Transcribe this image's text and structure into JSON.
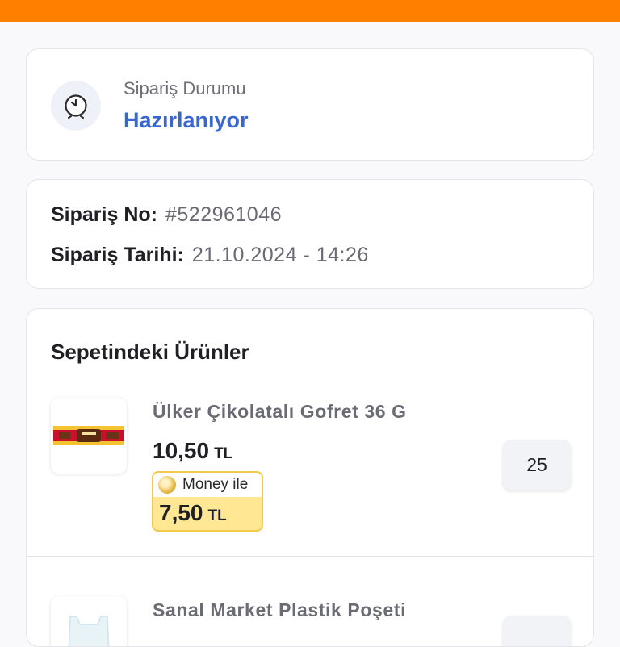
{
  "status": {
    "label": "Sipariş Durumu",
    "value": "Hazırlanıyor",
    "icon": "clock-icon",
    "value_color": "#3a67cf"
  },
  "order": {
    "number_label": "Sipariş No:",
    "number_value": "#522961046",
    "date_label": "Sipariş Tarihi:",
    "date_value": "21.10.2024 - 14:26"
  },
  "products": {
    "title": "Sepetindeki Ürünler",
    "items": [
      {
        "name": "Ülker Çikolatalı Gofret 36 G",
        "price": "10,50",
        "currency": "TL",
        "money_label": "Money ile",
        "money_price": "7,50",
        "money_currency": "TL",
        "quantity": "25"
      },
      {
        "name": "Sanal Market Plastik Poşeti",
        "quantity": ""
      }
    ]
  },
  "colors": {
    "topbar": "#ff7f00",
    "money_highlight": "#ffe793"
  }
}
